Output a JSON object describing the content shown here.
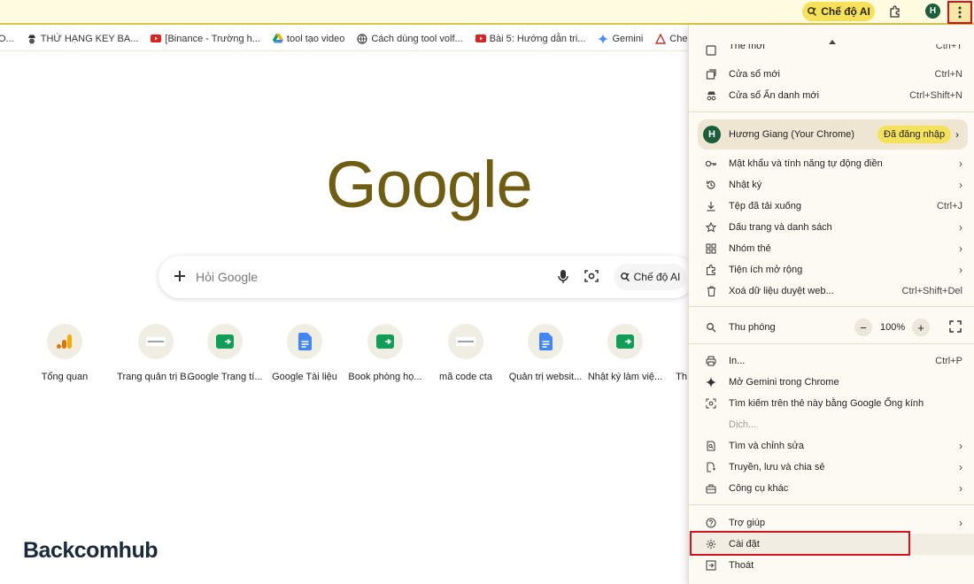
{
  "toolbar": {
    "ai_mode_label": "Chế độ AI",
    "avatar_letter": "H"
  },
  "bookmarks": [
    {
      "label": "O...",
      "icon": "globe-icon"
    },
    {
      "label": "THỨ HẠNG KEY BA...",
      "icon": "spy-icon"
    },
    {
      "label": "[Binance - Trường h...",
      "icon": "youtube-icon"
    },
    {
      "label": "tool tạo video",
      "icon": "drive-icon"
    },
    {
      "label": "Cách dùng tool volf...",
      "icon": "globe-icon"
    },
    {
      "label": "Bài 5: Hướng dẫn tri...",
      "icon": "youtube-icon"
    },
    {
      "label": "Gemini",
      "icon": "gemini-icon"
    },
    {
      "label": "Check Index Goog",
      "icon": "pdf-icon"
    }
  ],
  "google": {
    "logo": "Google",
    "placeholder": "Hỏi Google",
    "ai_mode_label": "Chế độ AI"
  },
  "shortcuts": [
    {
      "label": "Tổng quan",
      "icon": "analytics-icon"
    },
    {
      "label": "Trang quản trị B...",
      "icon": "site-icon"
    },
    {
      "label": "Google Trang tí...",
      "icon": "sheets-icon"
    },
    {
      "label": "Google Tài liệu",
      "icon": "docs-icon"
    },
    {
      "label": "Book phòng họ...",
      "icon": "sheets-icon"
    },
    {
      "label": "mã code cta",
      "icon": "site-icon"
    },
    {
      "label": "Quản trị websit...",
      "icon": "docs-icon"
    },
    {
      "label": "Nhật ký làm việ...",
      "icon": "sheets-icon"
    },
    {
      "label": "Th",
      "icon": "site-icon"
    }
  ],
  "watermark": "Backcomhub",
  "menu": {
    "new_tab": {
      "label": "Thẻ mới",
      "shortcut": "Ctrl+T"
    },
    "new_window": {
      "label": "Cửa sổ mới",
      "shortcut": "Ctrl+N"
    },
    "incognito": {
      "label": "Cửa sổ Ẩn danh mới",
      "shortcut": "Ctrl+Shift+N"
    },
    "profile": {
      "letter": "H",
      "name": "Hương Giang (Your Chrome)",
      "badge": "Đã đăng nhập"
    },
    "passwords": {
      "label": "Mật khẩu và tính năng tự động điền"
    },
    "history": {
      "label": "Nhật ký"
    },
    "downloads": {
      "label": "Tệp đã tải xuống",
      "shortcut": "Ctrl+J"
    },
    "bookmarks": {
      "label": "Dấu trang và danh sách"
    },
    "tab_groups": {
      "label": "Nhóm thẻ"
    },
    "extensions": {
      "label": "Tiện ích mở rộng"
    },
    "clear_data": {
      "label": "Xoá dữ liệu duyệt web...",
      "shortcut": "Ctrl+Shift+Del"
    },
    "zoom": {
      "label": "Thu phóng",
      "minus": "−",
      "value": "100%",
      "plus": "+"
    },
    "print": {
      "label": "In...",
      "shortcut": "Ctrl+P"
    },
    "gemini": {
      "label": "Mở Gemini trong Chrome"
    },
    "lens": {
      "label": "Tìm kiếm trên thẻ này bằng Google Ống kính"
    },
    "translate": {
      "label": "Dịch..."
    },
    "find_edit": {
      "label": "Tìm và chỉnh sửa"
    },
    "cast": {
      "label": "Truyền, lưu và chia sẻ"
    },
    "more_tools": {
      "label": "Công cụ khác"
    },
    "help": {
      "label": "Trợ giúp"
    },
    "settings": {
      "label": "Cài đặt"
    },
    "exit": {
      "label": "Thoát"
    }
  }
}
